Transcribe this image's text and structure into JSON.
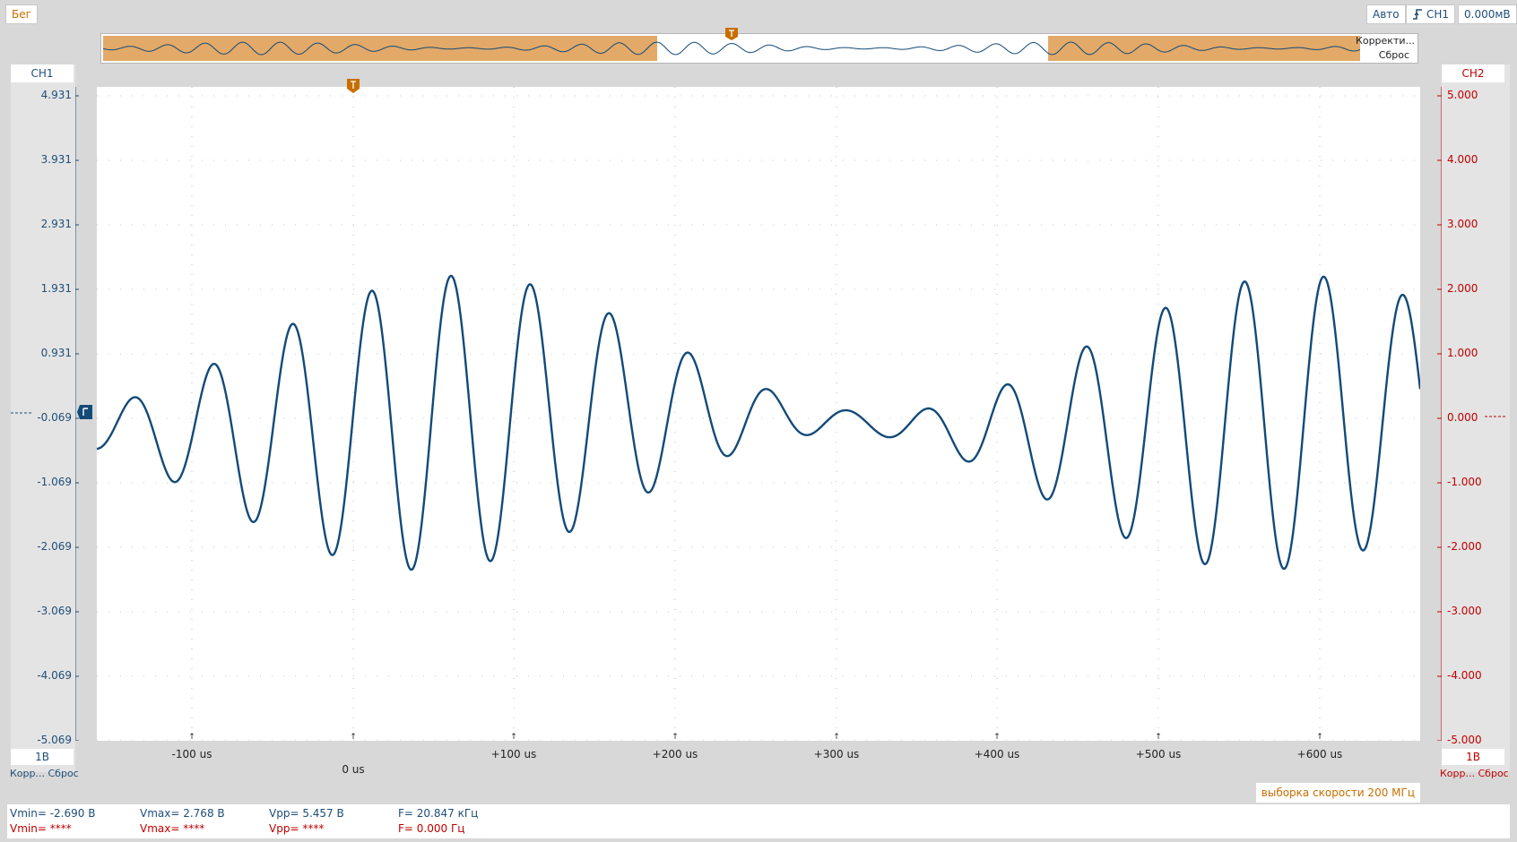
{
  "toolbar": {
    "run_label": "Бег",
    "trigger_mode": "Авто",
    "trigger_source": "CH1",
    "trigger_level": "0.000мВ"
  },
  "overview": {
    "correct_label": "Корректи...",
    "reset_label": "Сброс"
  },
  "ch1": {
    "label": "CH1",
    "color": "#1e4e78",
    "ticks": [
      "4.931",
      "3.931",
      "2.931",
      "1.931",
      "0.931",
      "-0.069",
      "-1.069",
      "-2.069",
      "-3.069",
      "-4.069",
      "-5.069"
    ],
    "scale": "1В",
    "correct_label": "Корр...",
    "reset_label": "Сброс"
  },
  "ch2": {
    "label": "CH2",
    "color": "#c00000",
    "ticks": [
      "5.000",
      "4.000",
      "3.000",
      "2.000",
      "1.000",
      "0.000",
      "-1.000",
      "-2.000",
      "-3.000",
      "-4.000",
      "-5.000"
    ],
    "scale": "1В",
    "correct_label": "Корр...",
    "reset_label": "Сброс"
  },
  "time_axis": {
    "labels": [
      "-100 us",
      "0 us",
      "+100 us",
      "+200 us",
      "+300 us",
      "+400 us",
      "+500 us",
      "+600 us"
    ]
  },
  "sample_rate_label": "выборка скорости 200 МГц",
  "measurements": {
    "ch1": {
      "vmin": "Vmin= -2.690 В",
      "vmax": "Vmax= 2.768 В",
      "vpp": "Vpp= 5.457 В",
      "freq": "F= 20.847 кГц"
    },
    "ch2": {
      "vmin": "Vmin= ****",
      "vmax": "Vmax= ****",
      "vpp": "Vpp= ****",
      "freq": "F= 0.000 Гц"
    }
  },
  "colors": {
    "trace": "#134a78",
    "accent": "#c86e00",
    "overview_highlight": "#e2a968"
  }
}
